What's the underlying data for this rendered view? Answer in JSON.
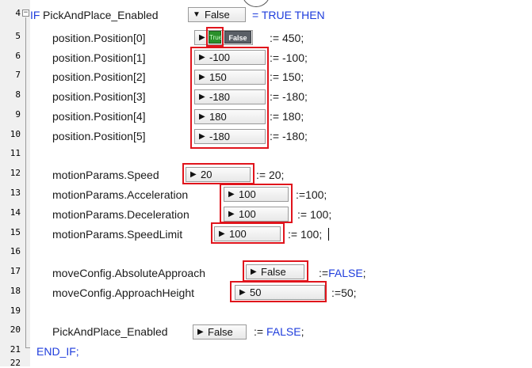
{
  "line_numbers": [
    "4",
    "5",
    "6",
    "7",
    "8",
    "9",
    "10",
    "11",
    "12",
    "13",
    "14",
    "15",
    "16",
    "17",
    "18",
    "19",
    "20",
    "21",
    "22"
  ],
  "fold_symbol": "−",
  "colors": {
    "keyword": "#1e3cdc",
    "highlight": "#e0141c",
    "toggle_true": "#2a8f2a",
    "toggle_false": "#5a5f66"
  },
  "dropdown_arrow": "▼",
  "play_arrow": "▶",
  "if_line": {
    "keyword": "IF",
    "variable": "PickAndPlace_Enabled",
    "dropdown_value": "False",
    "tail": "= TRUE THEN"
  },
  "position_rows": [
    {
      "label": "position.Position[0]",
      "toggle_true": "True",
      "toggle_false": "False",
      "assign": ":= 450;"
    },
    {
      "label": "position.Position[1]",
      "value": "-100",
      "assign": ":= -100;"
    },
    {
      "label": "position.Position[2]",
      "value": "150",
      "assign": ":= 150;"
    },
    {
      "label": "position.Position[3]",
      "value": "-180",
      "assign": ":= -180;"
    },
    {
      "label": "position.Position[4]",
      "value": "180",
      "assign": ":= 180;"
    },
    {
      "label": "position.Position[5]",
      "value": "-180",
      "assign": ":= -180;"
    }
  ],
  "motion_rows": [
    {
      "label": "motionParams.Speed",
      "value": "20",
      "assign": ":= 20;"
    },
    {
      "label": "motionParams.Acceleration",
      "value": "100",
      "assign": ":=100;"
    },
    {
      "label": "motionParams.Deceleration",
      "value": "100",
      "assign": ":= 100;"
    },
    {
      "label": "motionParams.SpeedLimit",
      "value": "100",
      "assign": ":= 100;"
    }
  ],
  "move_rows": [
    {
      "label": "moveConfig.AbsoluteApproach",
      "value": "False",
      "assign_op": ":=",
      "assign_kw": "FALSE",
      "assign_end": ";"
    },
    {
      "label": "moveConfig.ApproachHeight",
      "value": "50",
      "assign": ":=50;"
    }
  ],
  "final_row": {
    "label": "PickAndPlace_Enabled",
    "value": "False",
    "assign_op": ":=",
    "assign_kw": "FALSE",
    "assign_end": ";"
  },
  "end_if": "END_IF;"
}
